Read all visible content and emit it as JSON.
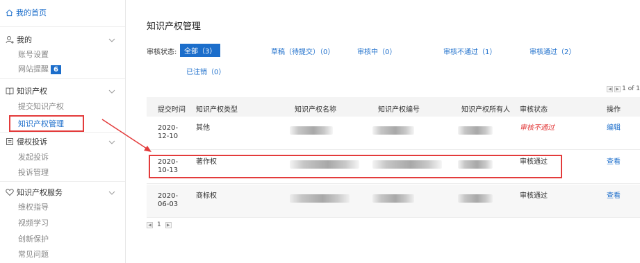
{
  "sidebar": {
    "home": {
      "label": "我的首页",
      "icon": "home-icon"
    },
    "sections": [
      {
        "title": "我的",
        "icon": "user-icon",
        "items": [
          {
            "label": "账号设置"
          },
          {
            "label": "网站提醒",
            "badge": "6"
          }
        ]
      },
      {
        "title": "知识产权",
        "icon": "book-icon",
        "items": [
          {
            "label": "提交知识产权"
          },
          {
            "label": "知识产权管理",
            "active": true
          }
        ]
      },
      {
        "title": "侵权投诉",
        "icon": "document-icon",
        "items": [
          {
            "label": "发起投诉"
          },
          {
            "label": "投诉管理"
          }
        ]
      },
      {
        "title": "知识产权服务",
        "icon": "heart-icon",
        "items": [
          {
            "label": "维权指导"
          },
          {
            "label": "视频学习"
          },
          {
            "label": "创新保护"
          },
          {
            "label": "常见问题"
          }
        ]
      }
    ]
  },
  "main": {
    "title": "知识产权管理",
    "filter_label": "审核状态:",
    "filters": [
      {
        "label": "全部（3）",
        "active": true
      },
      {
        "label": "草稿（待提交）（0）"
      },
      {
        "label": "审核中（0）"
      },
      {
        "label": "审核不通过（1）"
      },
      {
        "label": "审核通过（2）"
      },
      {
        "label": "已注销（0）"
      }
    ],
    "pager_top": "1 of 1",
    "table": {
      "columns": [
        "提交时间",
        "知识产权类型",
        "知识产权名称",
        "知识产权编号",
        "知识产权所有人",
        "审核状态",
        "操作"
      ],
      "rows": [
        {
          "date": "2020-12-10",
          "type": "其他",
          "status": "审核不通过",
          "action": "编辑"
        },
        {
          "date": "2020-10-13",
          "type": "著作权",
          "status": "审核通过",
          "action": "查看"
        },
        {
          "date": "2020-06-03",
          "type": "商标权",
          "status": "审核通过",
          "action": "查看"
        }
      ]
    },
    "pager_bottom": {
      "page": "1"
    }
  },
  "colors": {
    "accent": "#1c6ecb",
    "error": "#e23a3a",
    "annotation": "#e33b3b"
  }
}
